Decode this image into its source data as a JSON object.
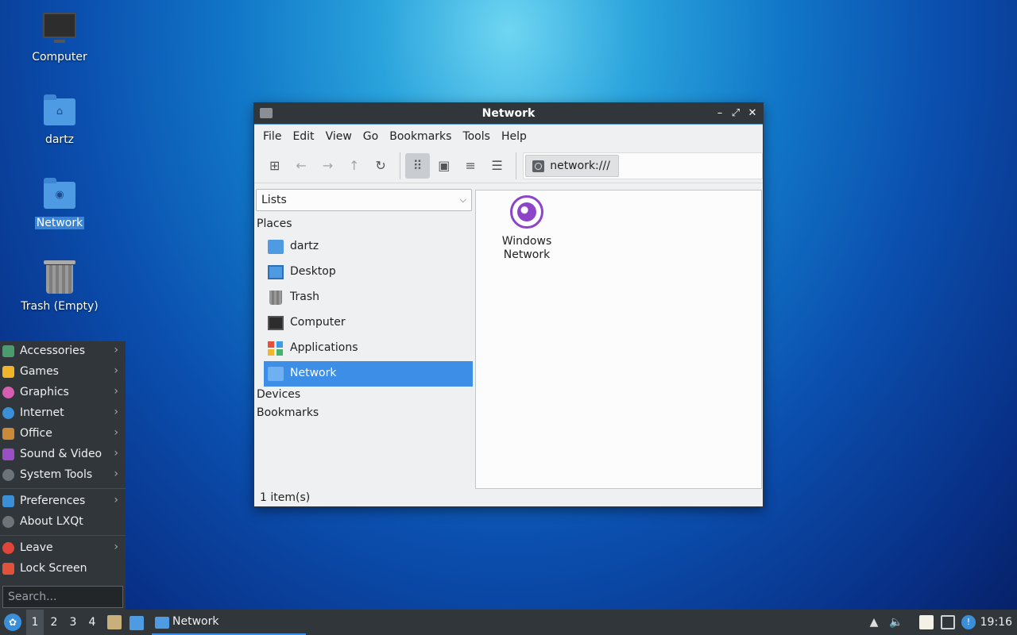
{
  "desktop": {
    "icons": [
      {
        "label": "Computer"
      },
      {
        "label": "dartz"
      },
      {
        "label": "Network"
      },
      {
        "label": "Trash (Empty)"
      }
    ]
  },
  "window": {
    "title": "Network",
    "controls": {
      "minimize": "–",
      "maximize": "⤢",
      "close": "✕"
    },
    "menu": [
      "File",
      "Edit",
      "View",
      "Go",
      "Bookmarks",
      "Tools",
      "Help"
    ],
    "path": "network:///",
    "side_pane": {
      "mode": "Lists",
      "places_header": "Places",
      "places": [
        "dartz",
        "Desktop",
        "Trash",
        "Computer",
        "Applications",
        "Network"
      ],
      "selected": "Network",
      "devices_header": "Devices",
      "bookmarks_header": "Bookmarks"
    },
    "files": [
      {
        "line1": "Windows",
        "line2": "Network",
        "icon": "globe-icon"
      }
    ],
    "status": "1 item(s)"
  },
  "start_menu": {
    "items": [
      "Accessories",
      "Games",
      "Graphics",
      "Internet",
      "Office",
      "Sound & Video",
      "System Tools"
    ],
    "settings": [
      "Preferences",
      "About LXQt"
    ],
    "session": [
      "Leave",
      "Lock Screen"
    ],
    "search_placeholder": "Search..."
  },
  "taskbar": {
    "desktops": [
      "1",
      "2",
      "3",
      "4"
    ],
    "current_desktop": "1",
    "task_label": "Network",
    "clock": "19:16"
  },
  "colors": {
    "accent": "#3d8ee6",
    "panel": "#31363b",
    "globe": "#8d44c8"
  }
}
